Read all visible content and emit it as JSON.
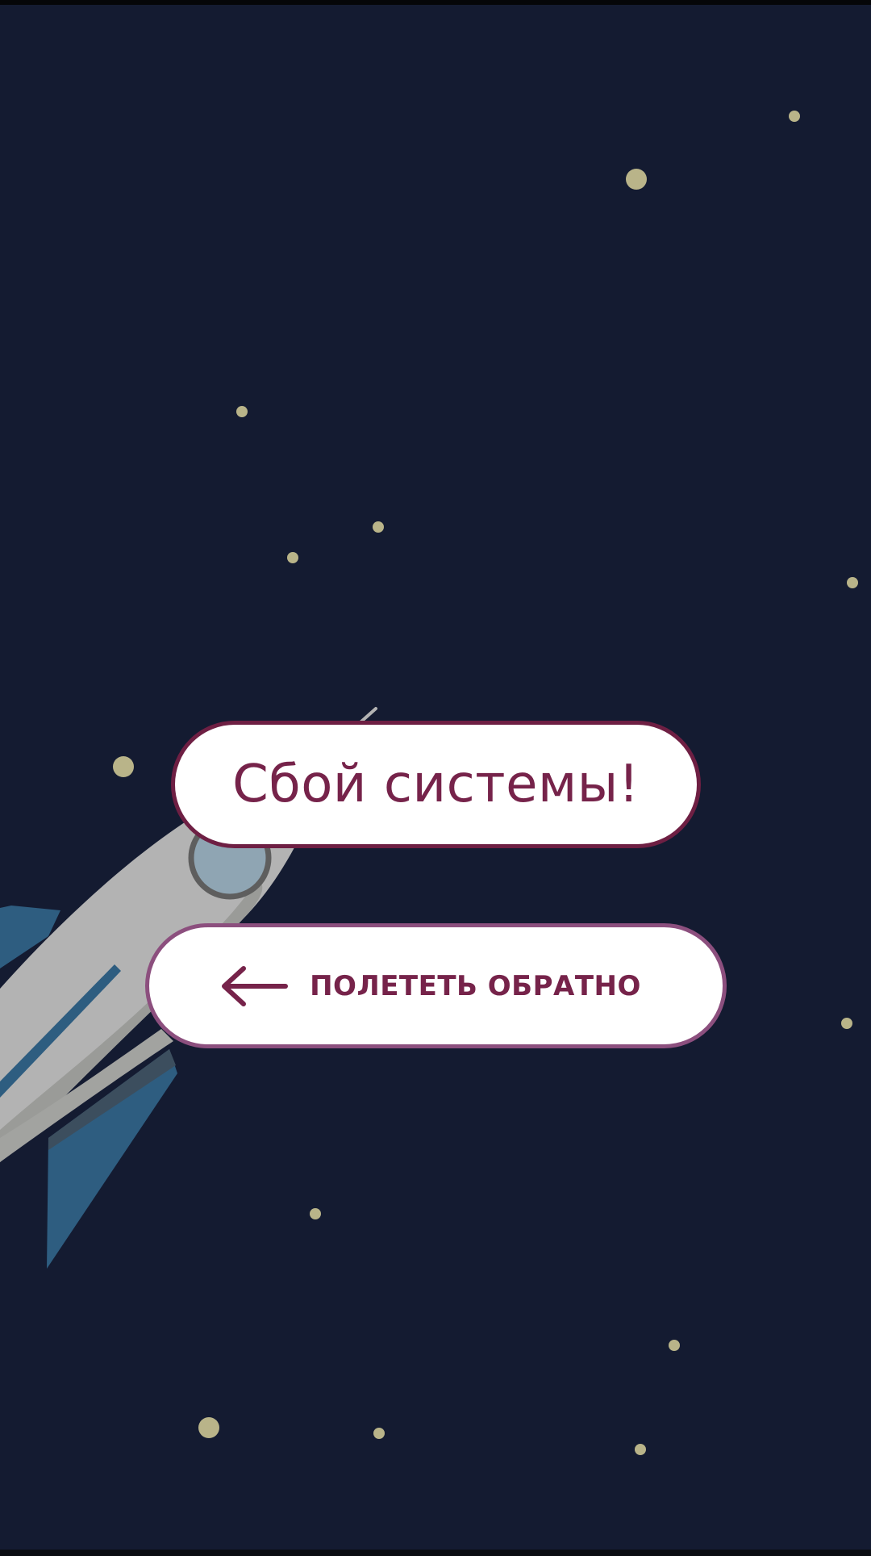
{
  "error": {
    "title": "Сбой системы!"
  },
  "back_button": {
    "label": "ПОЛЕТЕТЬ ОБРАТНО",
    "icon": "arrow-left-icon"
  },
  "colors": {
    "background": "#141b31",
    "accent": "#76234a",
    "star": "#b9b489",
    "rocket_body": "#b3b3b3",
    "rocket_fin": "#2e5d80"
  }
}
